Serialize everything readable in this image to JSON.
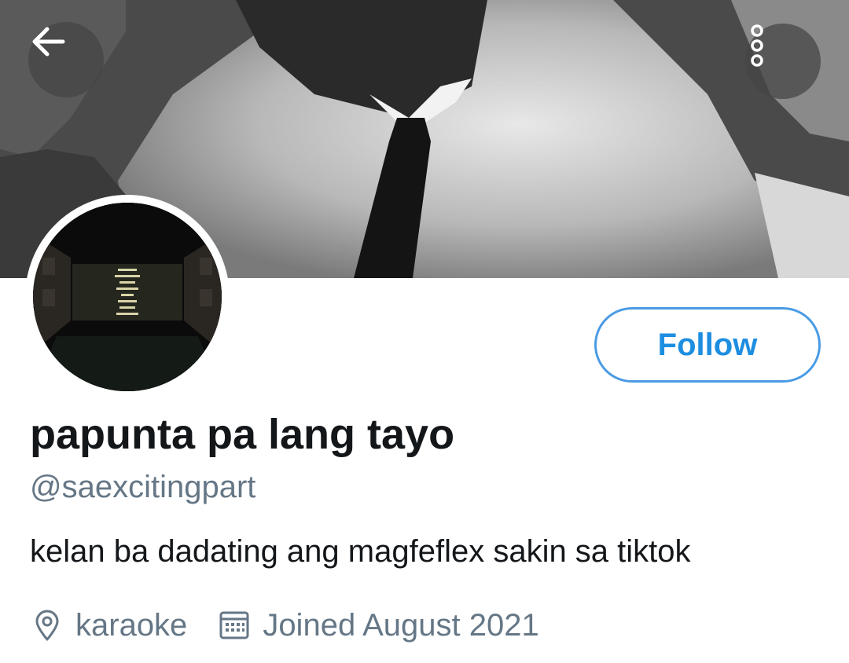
{
  "header": {
    "back_icon": "arrow-left-icon",
    "more_icon": "more-vertical-icon"
  },
  "profile": {
    "follow_label": "Follow",
    "display_name": "papunta pa lang tayo",
    "handle": "@saexcitingpart",
    "bio": "kelan ba dadating ang magfeflex sakin sa tiktok",
    "location": "karaoke",
    "joined": "Joined August 2021"
  },
  "colors": {
    "accent": "#1d8ee0",
    "secondary_text": "#657786",
    "primary_text": "#14171a"
  }
}
